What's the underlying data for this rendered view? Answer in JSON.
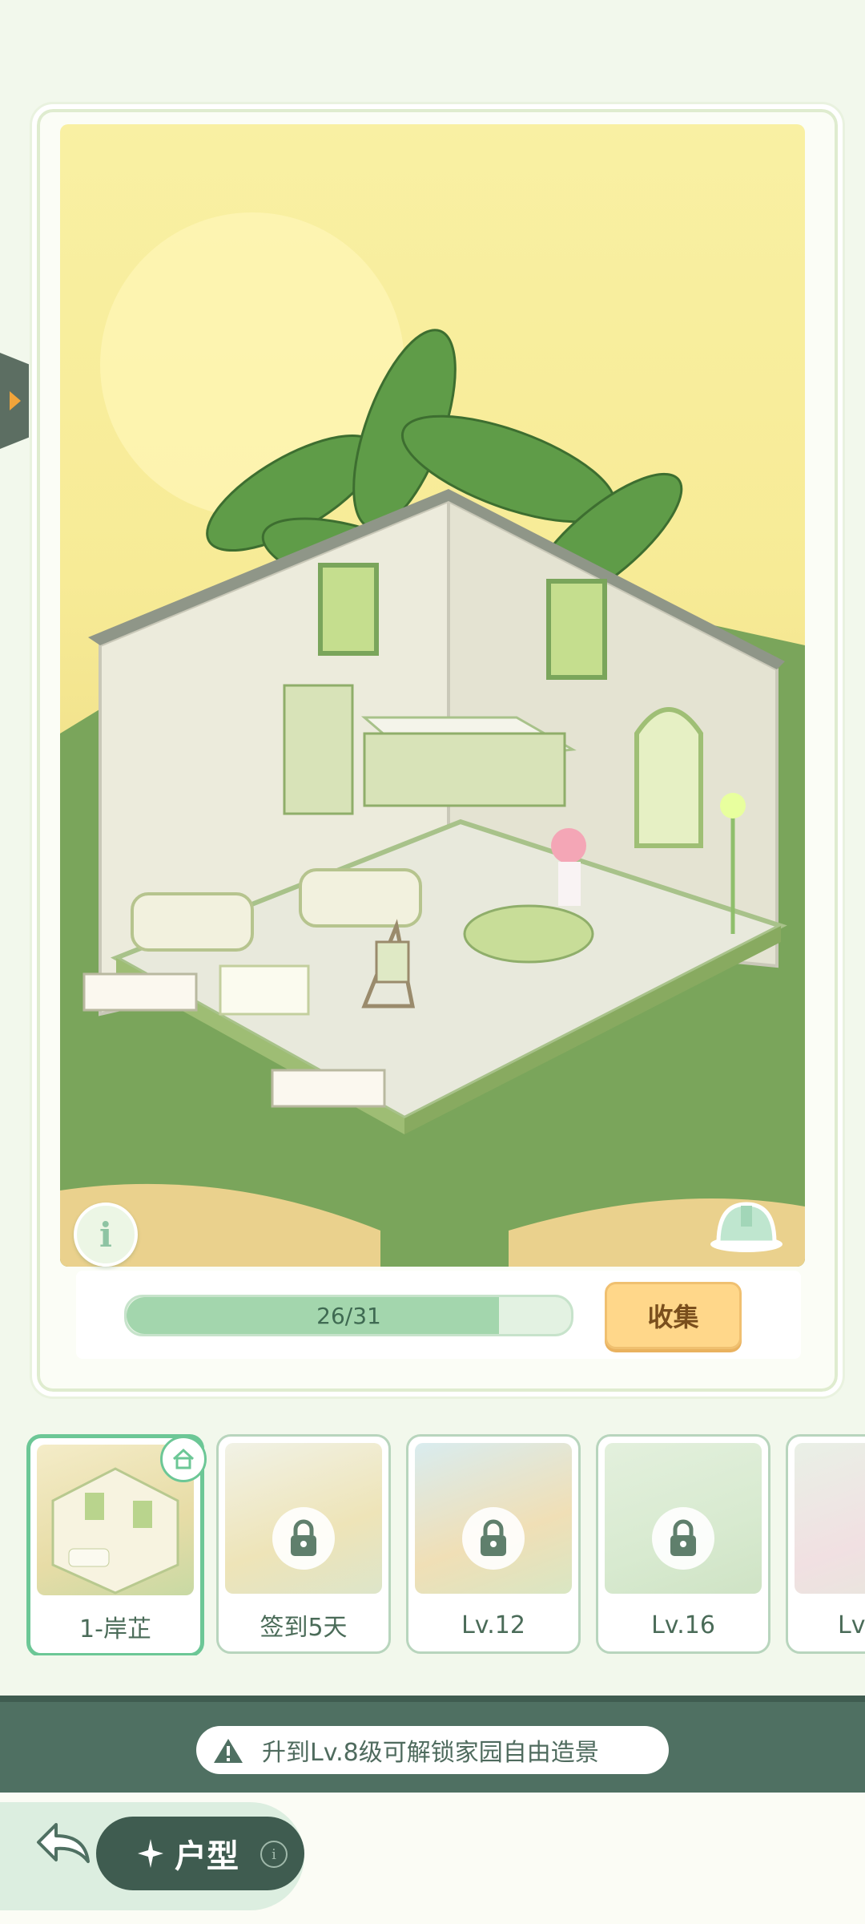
{
  "showcase": {
    "progress": {
      "current": 26,
      "total": 31,
      "label": "26/31",
      "fraction": 0.839
    },
    "collect_label": "收集",
    "info_icon": "info-icon",
    "helmet_icon": "helmet-icon"
  },
  "rooms": [
    {
      "label": "1-岸芷",
      "locked": false,
      "active": true
    },
    {
      "label": "签到5天",
      "locked": true,
      "active": false
    },
    {
      "label": "Lv.12",
      "locked": true,
      "active": false
    },
    {
      "label": "Lv.16",
      "locked": true,
      "active": false
    },
    {
      "label": "Lv",
      "locked": true,
      "active": false
    }
  ],
  "notice": {
    "text": "升到Lv.8级可解锁家园自由造景"
  },
  "bottom": {
    "tab_label": "户型"
  },
  "colors": {
    "accent": "#6cc796",
    "notice_bg": "#4f7062",
    "collect_bg": "#ffd78a"
  }
}
